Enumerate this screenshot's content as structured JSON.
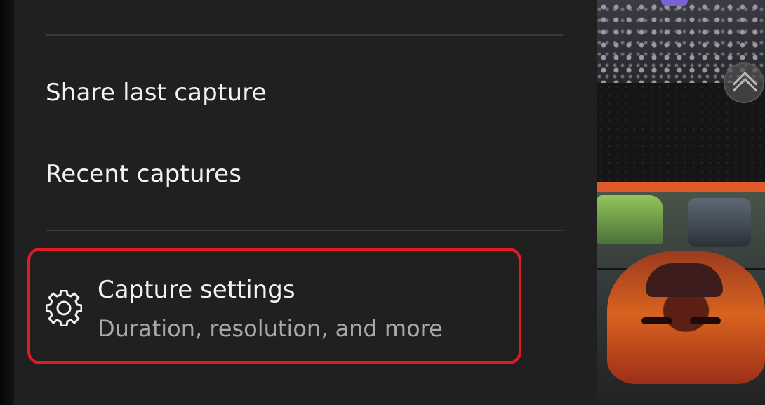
{
  "menu": {
    "items": [
      {
        "label": "Share last capture"
      },
      {
        "label": "Recent captures"
      }
    ],
    "capture_settings": {
      "title": "Capture settings",
      "subtitle": "Duration, resolution, and more",
      "icon": "gear-icon",
      "highlight_color": "#e31b23"
    }
  }
}
